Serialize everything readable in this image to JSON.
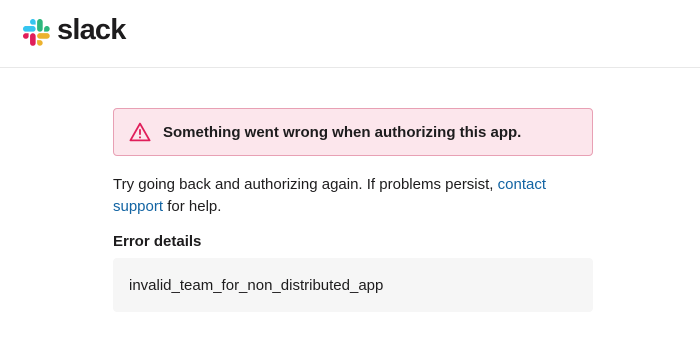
{
  "header": {
    "logo_text": "slack",
    "logo_icon": "slack-hash-icon"
  },
  "alert": {
    "icon": "warning-triangle-icon",
    "text": "Something went wrong when authorizing this app.",
    "color": "#e01e5a",
    "background": "#fce6ec"
  },
  "message": {
    "before_link": "Try going back and authorizing again. If problems persist, ",
    "link_text": "contact support",
    "after_link": " for help.",
    "link_color": "#1264a3"
  },
  "error_details": {
    "label": "Error details",
    "value": "invalid_team_for_non_distributed_app"
  }
}
